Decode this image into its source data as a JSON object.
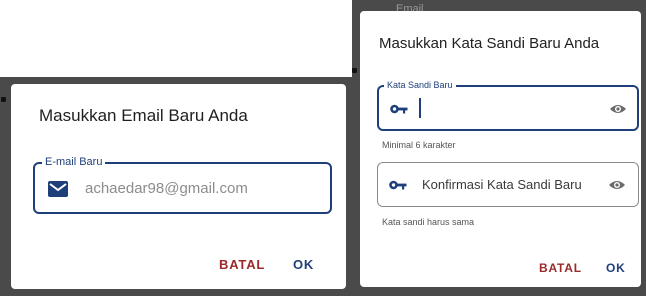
{
  "background": {
    "ghost_text": "Email"
  },
  "email_dialog": {
    "title": "Masukkan Email Baru Anda",
    "field": {
      "label": "E-mail Baru",
      "value": "achaedar98@gmail.com",
      "icon": "mail-icon"
    },
    "cancel_label": "BATAL",
    "ok_label": "OK"
  },
  "password_dialog": {
    "title": "Masukkan Kata Sandi Baru Anda",
    "new_password": {
      "label": "Kata Sandi Baru",
      "value": "",
      "icon": "key-icon",
      "toggle_icon": "eye-icon",
      "helper": "Minimal 6 karakter"
    },
    "confirm_password": {
      "placeholder": "Konfirmasi Kata Sandi Baru",
      "icon": "key-icon",
      "toggle_icon": "eye-icon",
      "helper": "Kata sandi harus sama"
    },
    "cancel_label": "BATAL",
    "ok_label": "OK"
  },
  "colors": {
    "accent": "#1f3f7a",
    "cancel": "#9b2a2a",
    "overlay": "#4a4a4a"
  }
}
